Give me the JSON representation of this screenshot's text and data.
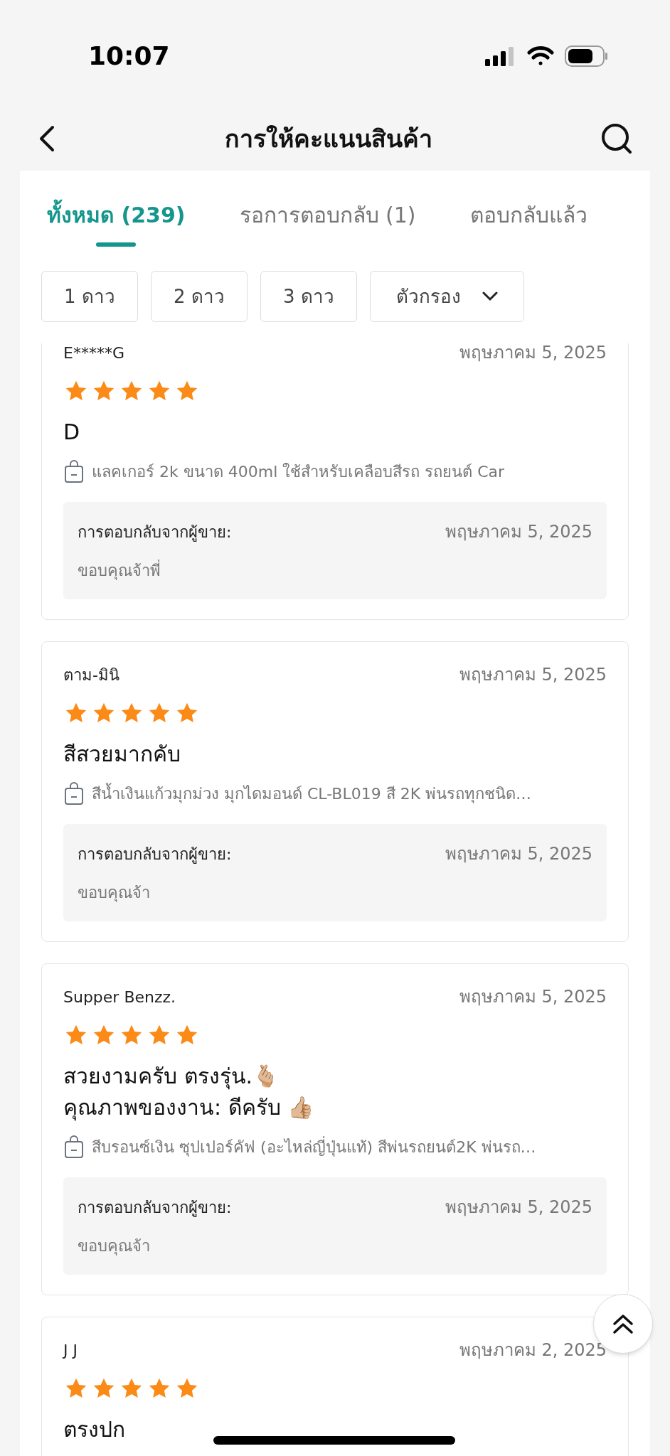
{
  "status_bar": {
    "time": "10:07"
  },
  "header": {
    "title": "การให้คะแนนสินค้า"
  },
  "tabs": [
    {
      "label": "ทั้งหมด (239)",
      "selected": true
    },
    {
      "label": "รอการตอบกลับ (1)",
      "selected": false
    },
    {
      "label": "ตอบกลับแล้ว",
      "selected": false
    }
  ],
  "filters": [
    {
      "label": "1 ดาว",
      "kind": "chip"
    },
    {
      "label": "2 ดาว",
      "kind": "chip"
    },
    {
      "label": "3 ดาว",
      "kind": "chip"
    },
    {
      "label": "ตัวกรอง",
      "kind": "dropdown"
    }
  ],
  "reviews": [
    {
      "user": "E*****G",
      "date": "พฤษภาคม 5, 2025",
      "stars": 5,
      "text": [
        "D"
      ],
      "product": "แลคเกอร์ 2k ขนาด 400ml ใช้สำหรับเคลือบสีรถ รถยนต์ Car",
      "reply": {
        "label": "การตอบกลับจากผู้ขาย:",
        "date": "พฤษภาคม 5, 2025",
        "text": "ขอบคุณจ้าพี่"
      }
    },
    {
      "user": "ตาม-มินิ",
      "date": "พฤษภาคม 5, 2025",
      "stars": 5,
      "text": [
        "สีสวยมากคับ"
      ],
      "product": "สีน้ำเงินแก้วมุกม่วง มุกไดมอนด์ CL-BL019 สี 2K พ่นรถทุกชนิด…",
      "reply": {
        "label": "การตอบกลับจากผู้ขาย:",
        "date": "พฤษภาคม 5, 2025",
        "text": "ขอบคุณจ้า"
      }
    },
    {
      "user": "Supper Benzz.",
      "date": "พฤษภาคม 5, 2025",
      "stars": 5,
      "text": [
        "สวยงามครับ ตรงรุ่น.🫰🏼",
        "คุณภาพของงาน: ดีครับ 👍🏼"
      ],
      "product": "สีบรอนซ์เงิน ซุปเปอร์คัฟ (อะไหล่ญี่ปุ่นแท้)  สีพ่นรถยนต์2K พ่นรถ…",
      "reply": {
        "label": "การตอบกลับจากผู้ขาย:",
        "date": "พฤษภาคม 5, 2025",
        "text": "ขอบคุณจ้า"
      }
    },
    {
      "user": "J J",
      "date": "พฤษภาคม 2, 2025",
      "stars": 5,
      "text": [
        "ตรงปก"
      ]
    }
  ]
}
